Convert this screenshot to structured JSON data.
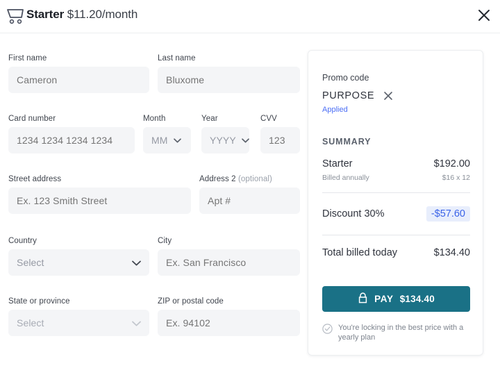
{
  "header": {
    "cart_icon": "shopping-cart-icon",
    "plan_name": "Starter",
    "plan_price": "$11.20/month",
    "close_icon": "close-icon"
  },
  "form": {
    "first_name": {
      "label": "First name",
      "placeholder": "Cameron"
    },
    "last_name": {
      "label": "Last name",
      "placeholder": "Bluxome"
    },
    "card_number": {
      "label": "Card number",
      "placeholder": "1234 1234 1234 1234"
    },
    "month": {
      "label": "Month",
      "placeholder": "MM"
    },
    "year": {
      "label": "Year",
      "placeholder": "YYYY"
    },
    "cvv": {
      "label": "CVV",
      "placeholder": "123"
    },
    "street": {
      "label": "Street address",
      "placeholder": "Ex. 123 Smith Street"
    },
    "address2": {
      "label": "Address 2",
      "label_optional": "(optional)",
      "placeholder": "Apt #"
    },
    "country": {
      "label": "Country",
      "placeholder": "Select"
    },
    "city": {
      "label": "City",
      "placeholder": "Ex. San Francisco"
    },
    "state": {
      "label": "State or province",
      "placeholder": "Select"
    },
    "zip": {
      "label": "ZIP or postal code",
      "placeholder": "Ex. 94102"
    }
  },
  "summary": {
    "promo_label": "Promo code",
    "promo_code": "PURPOSE",
    "promo_remove_icon": "close-icon",
    "promo_status": "Applied",
    "title": "SUMMARY",
    "plan_row": {
      "label": "Starter",
      "value": "$192.00"
    },
    "plan_sub_row": {
      "label": "Billed annually",
      "value": "$16 x 12"
    },
    "discount_row": {
      "label": "Discount 30%",
      "value": "-$57.60"
    },
    "total_row": {
      "label": "Total billed today",
      "value": "$134.40"
    },
    "pay_button": {
      "lock_icon": "lock-icon",
      "label": "PAY",
      "amount": "$134.40"
    },
    "assurance": {
      "icon": "check-circle-icon",
      "text": "You're locking in the best price with a yearly plan"
    }
  },
  "colors": {
    "accent_teal": "#1a7186",
    "discount_blue": "#3a63e8",
    "discount_bg": "#e8eefc",
    "applied_blue": "#4b6ef5",
    "input_bg": "#f4f5f7"
  }
}
